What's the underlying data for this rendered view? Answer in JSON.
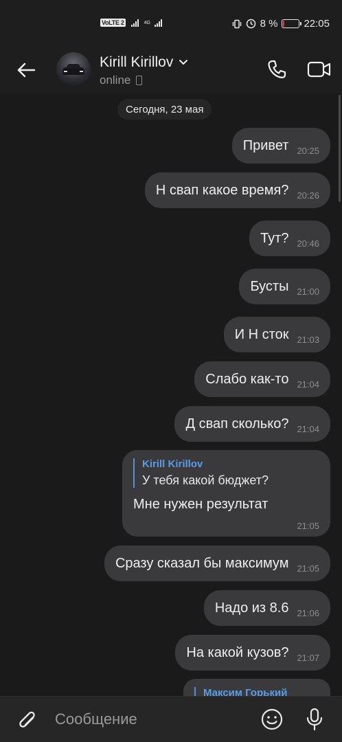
{
  "status_bar": {
    "volte": "VoLTE 2",
    "network": "4G",
    "battery_text": "8 %",
    "battery_level": 0.08,
    "battery_color": "#e03a3a",
    "time": "22:05"
  },
  "header": {
    "back_icon": "arrow-left-icon",
    "contact_name": "Kirill Kirillov",
    "status": "online",
    "call_icon": "phone-icon",
    "video_icon": "video-camera-icon"
  },
  "chat": {
    "date": "Сегодня, 23 мая",
    "messages": [
      {
        "text": "Привет",
        "time": "20:25"
      },
      {
        "text": "Н свап какое время?",
        "time": "20:26"
      },
      {
        "text": "Тут?",
        "time": "20:46"
      },
      {
        "text": "Бусты",
        "time": "21:00"
      },
      {
        "text": "И Н сток",
        "time": "21:03"
      },
      {
        "text": "Слабо как-то",
        "time": "21:04"
      },
      {
        "text": "Д свап сколько?",
        "time": "21:04"
      },
      {
        "text": "Сразу сказал бы максимум",
        "time": "21:05"
      },
      {
        "text": "Надо из 8.6",
        "time": "21:06"
      },
      {
        "text": "На какой кузов?",
        "time": "21:07"
      }
    ],
    "reply_message": {
      "quote_author": "Kirill Kirillov",
      "quote_text": "У тебя какой бюджет?",
      "text": "Мне нужен результат",
      "time": "21:05"
    },
    "partial_message": {
      "quote_author": "Максим Горький"
    }
  },
  "composer": {
    "placeholder": "Сообщение",
    "attach_icon": "paperclip-icon",
    "emoji_icon": "smile-icon",
    "mic_icon": "microphone-icon"
  },
  "colors": {
    "background": "#1a1a1a",
    "bubble": "#3a3a3c",
    "accent": "#5b9be6"
  }
}
